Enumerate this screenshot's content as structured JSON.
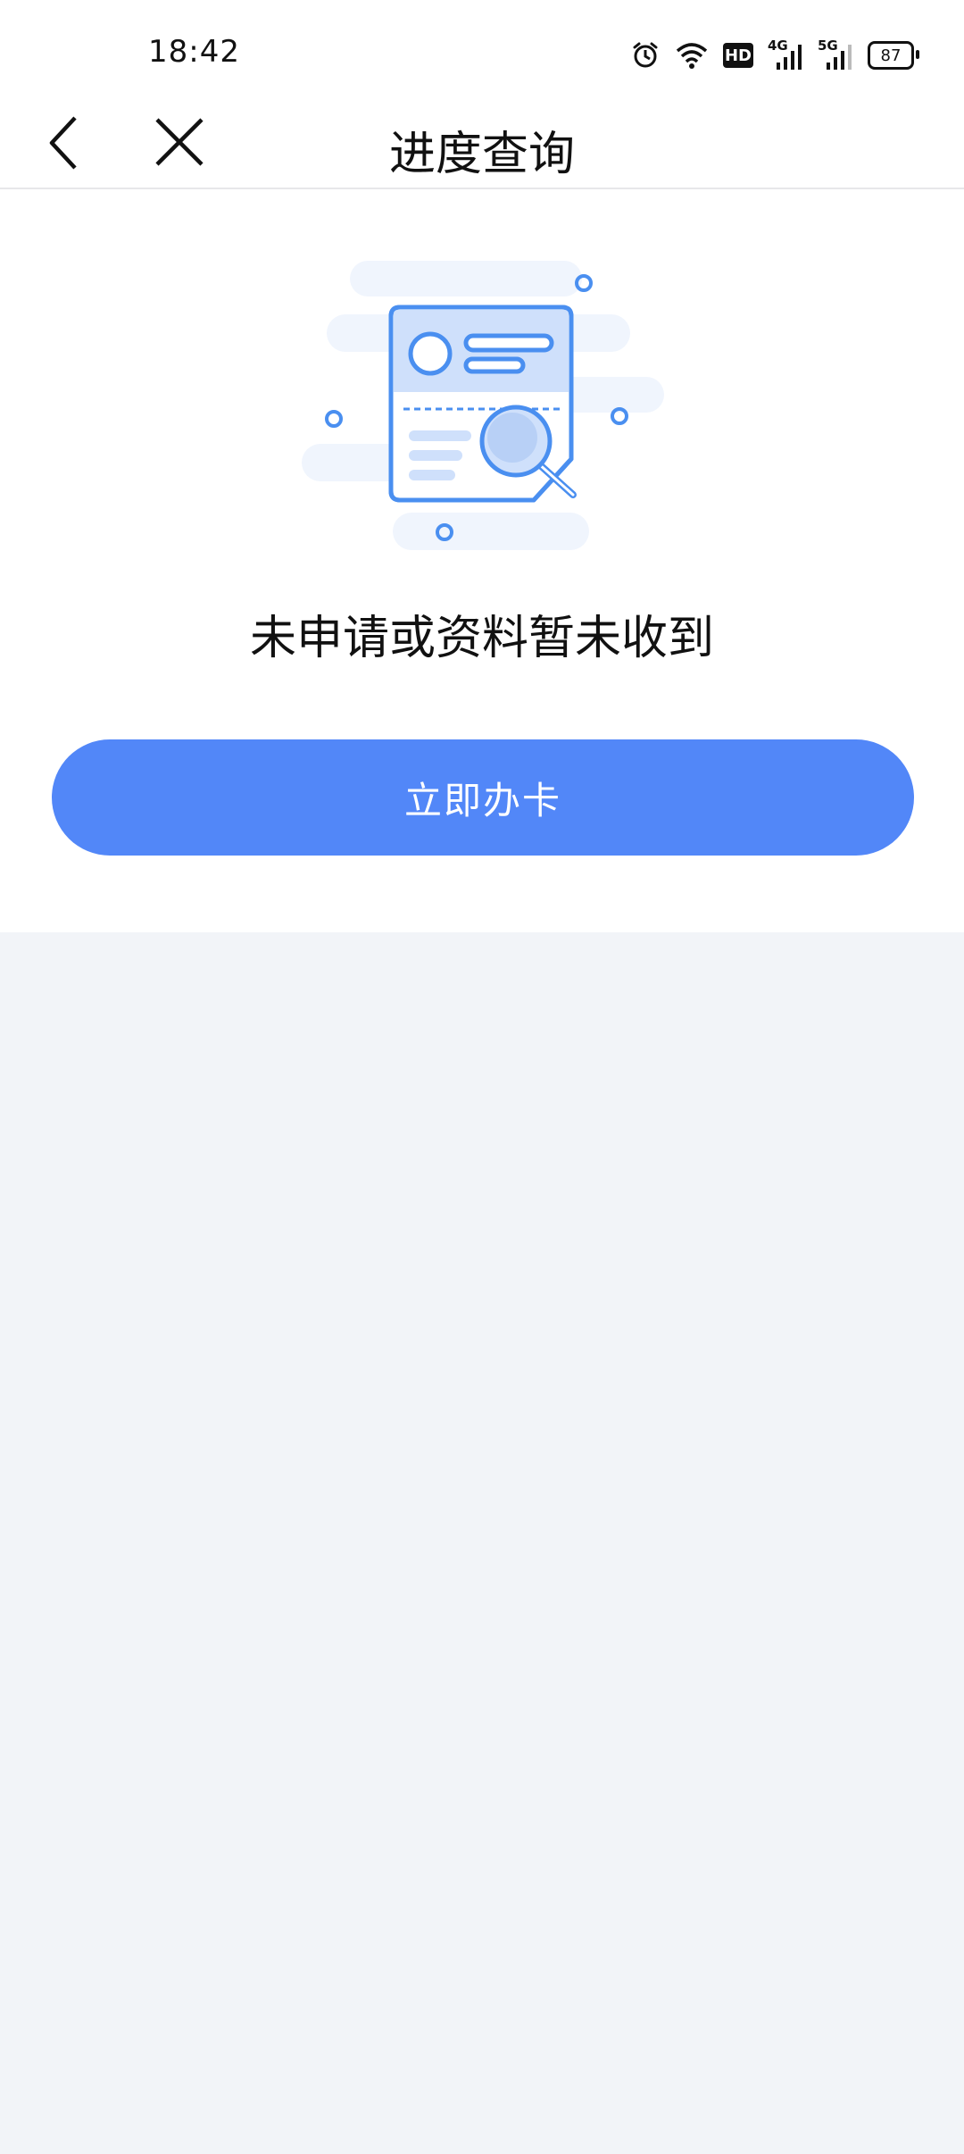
{
  "status_bar": {
    "time": "18:42",
    "hd_label": "HD",
    "network_4g": "4G",
    "network_5g": "5G",
    "battery": "87",
    "icons": [
      "alarm-icon",
      "wifi-icon",
      "hd-icon",
      "signal-4g-icon",
      "signal-5g-icon",
      "battery-icon"
    ]
  },
  "nav": {
    "title": "进度查询",
    "back_icon": "chevron-left-icon",
    "close_icon": "close-icon"
  },
  "main": {
    "illustration": "document-search-icon",
    "message": "未申请或资料暂未收到",
    "apply_button_label": "立即办卡"
  },
  "colors": {
    "accent": "#5287f8",
    "background": "#f2f4f8",
    "card": "#ffffff",
    "illustration_blue": "#4a8ff0",
    "illustration_light": "#cfe0fb"
  }
}
